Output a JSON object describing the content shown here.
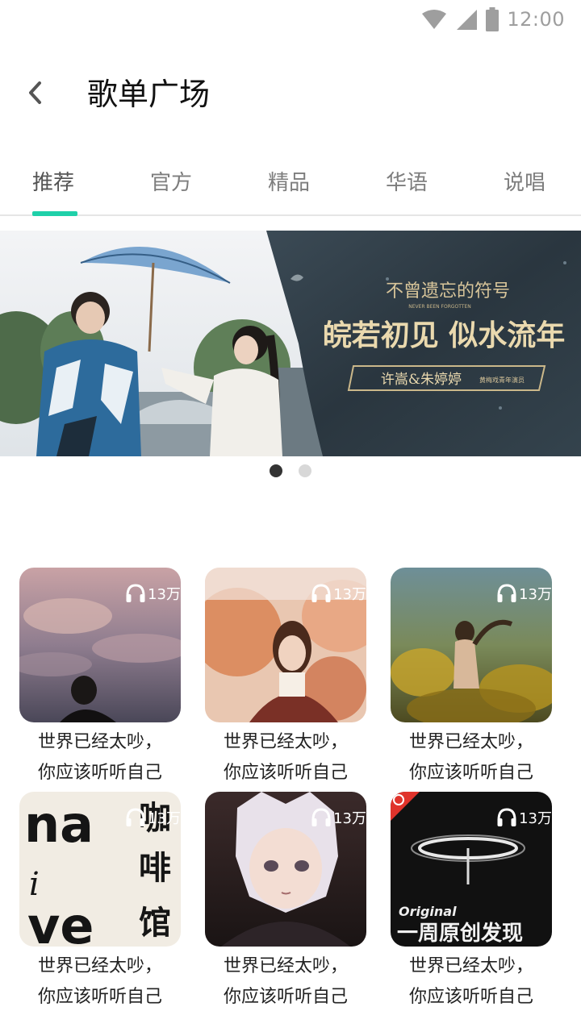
{
  "status_bar": {
    "time": "12:00",
    "icons": [
      "wifi-icon",
      "signal-icon",
      "battery-icon"
    ]
  },
  "header": {
    "title": "歌单广场",
    "back_icon": "chevron-left-icon"
  },
  "tabs": [
    {
      "label": "推荐",
      "active": true
    },
    {
      "label": "官方",
      "active": false
    },
    {
      "label": "精品",
      "active": false
    },
    {
      "label": "华语",
      "active": false
    },
    {
      "label": "说唱",
      "active": false
    }
  ],
  "accent_color": "#1fd0a9",
  "banner": {
    "logo_text": "不曾遗忘的符号",
    "logo_sub": "NEVER BEEN FORGOTTEN",
    "headline": "皖若初见 似水流年",
    "artists": "许嵩&朱婷婷",
    "artists_note": "黄梅戏青年演员",
    "slides_total": 2,
    "slide_active": 1
  },
  "playlists": [
    {
      "plays": "13万",
      "title_line1": "世界已经太吵，",
      "title_line2": "你应该听听自己"
    },
    {
      "plays": "13万",
      "title_line1": "世界已经太吵，",
      "title_line2": "你应该听听自己"
    },
    {
      "plays": "13万",
      "title_line1": "世界已经太吵，",
      "title_line2": "你应该听听自己"
    },
    {
      "plays": "13万",
      "title_line1": "世界已经太吵，",
      "title_line2": "你应该听听自己",
      "cover_text": {
        "a": "na",
        "b": "ve",
        "c": "i",
        "d1": "咖",
        "d2": "啡",
        "d3": "馆"
      }
    },
    {
      "plays": "13万",
      "title_line1": "世界已经太吵，",
      "title_line2": "你应该听听自己"
    },
    {
      "plays": "13万",
      "title_line1": "世界已经太吵，",
      "title_line2": "你应该听听自己",
      "cover_text": {
        "small": "Original",
        "big": "一周原创发现"
      }
    }
  ]
}
